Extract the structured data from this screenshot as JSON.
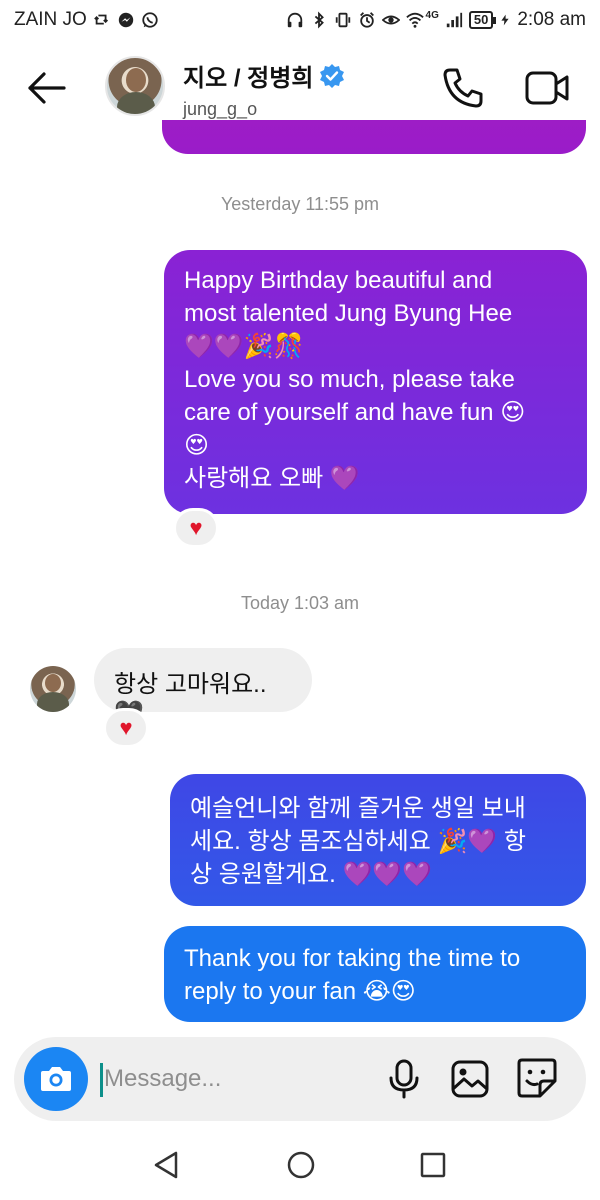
{
  "status_bar": {
    "carrier": "ZAIN JO",
    "battery": "50",
    "time": "2:08 am",
    "network": "4G"
  },
  "header": {
    "name": "지오 / 정병희",
    "handle": "jung_g_o"
  },
  "timestamps": {
    "first": "Yesterday 11:55 pm",
    "second": "Today 1:03 am"
  },
  "messages": {
    "birthday": {
      "lines": [
        "Happy Birthday beautiful and",
        "most talented Jung Byung Hee",
        "💜💜🎉🎊",
        "Love you so much, please take",
        "care of yourself and have fun 😍",
        "😍",
        "사랑해요 오빠 💜"
      ],
      "reaction": "♥"
    },
    "incoming": {
      "text": "항상 고마워요..🖤",
      "reaction": "♥"
    },
    "korean_reply": {
      "lines": [
        "예슬언니와 함께 즐거운 생일 보내",
        "세요.  항상 몸조심하세요 🎉💜 항",
        "상 응원할게요. 💜💜💜"
      ]
    },
    "thanks": {
      "lines": [
        "Thank you for taking the time to",
        "reply to your fan 😭😍"
      ]
    }
  },
  "composer": {
    "placeholder": "Message..."
  },
  "colors": {
    "purple_bubble": "#7a2bdc",
    "blue_bubble": "#1b77f0",
    "camera_button": "#1b86f3",
    "heart": "#e0162b"
  }
}
